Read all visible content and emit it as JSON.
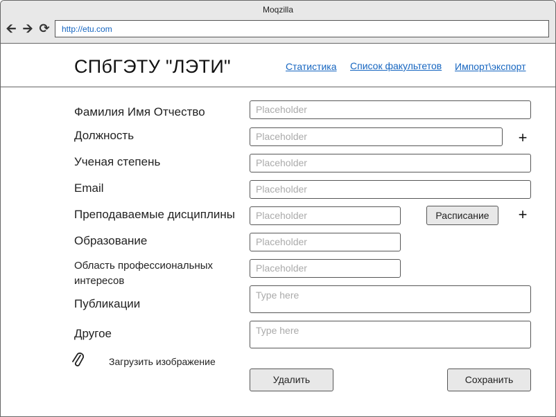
{
  "browser": {
    "title": "Moqzilla",
    "url": "http://etu.com"
  },
  "header": {
    "site_title": "СПбГЭТУ \"ЛЭТИ\"",
    "nav": [
      "Статистика",
      "Список факультетов",
      "Импорт\\экспорт"
    ]
  },
  "form": {
    "fields": [
      {
        "label": "Фамилия Имя Отчество",
        "placeholder": "Placeholder"
      },
      {
        "label": "Должность",
        "placeholder": "Placeholder"
      },
      {
        "label": "Ученая степень",
        "placeholder": "Placeholder"
      },
      {
        "label": "Email",
        "placeholder": "Placeholder"
      },
      {
        "label": "Преподаваемые дисциплины",
        "placeholder": "Placeholder"
      },
      {
        "label": "Образование",
        "placeholder": "Placeholder"
      },
      {
        "label": "Область профессиональных интересов",
        "placeholder": "Placeholder"
      },
      {
        "label": "Публикации",
        "placeholder": "Type here"
      },
      {
        "label": "Другое",
        "placeholder": "Type here"
      }
    ],
    "schedule_button": "Расписание",
    "add_symbol": "+",
    "upload_label": "Загрузить изображение",
    "delete_button": "Удалить",
    "save_button": "Сохранить"
  },
  "colors": {
    "link": "#1565c0",
    "chrome": "#e8e8e8",
    "border": "#555555"
  },
  "icons": [
    "back-arrow-icon",
    "forward-arrow-icon",
    "reload-icon",
    "paperclip-icon",
    "plus-icon"
  ]
}
